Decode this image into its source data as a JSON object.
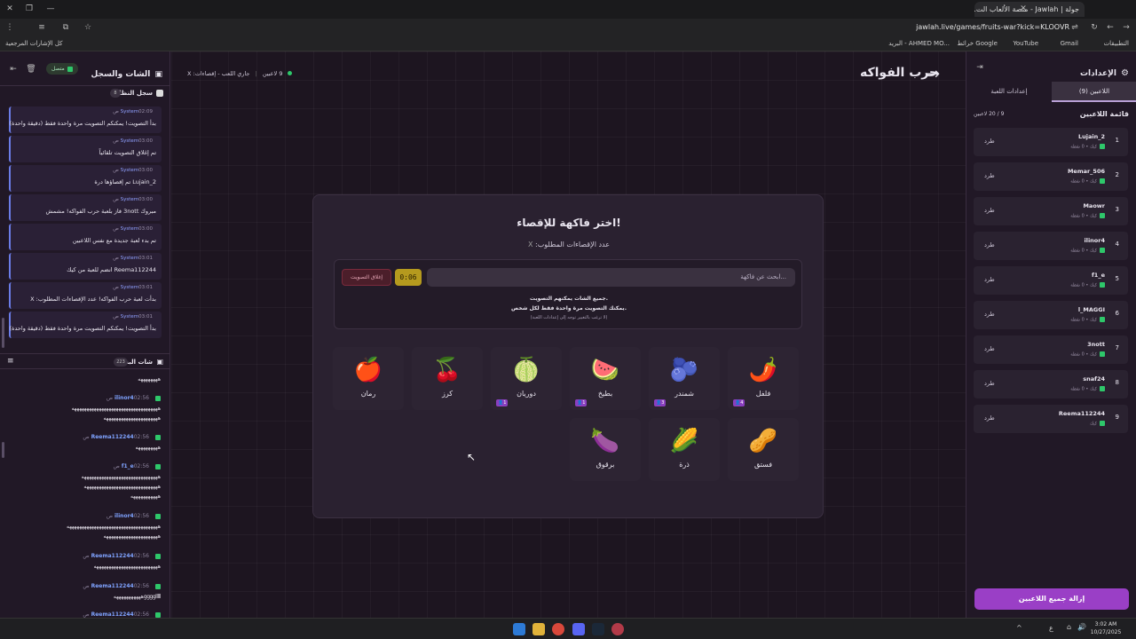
{
  "browser": {
    "tab_title": "جولة | Jawlah - منصة الألعاب الت...",
    "url": "jawlah.live/games/fruits-war?kick=KLOOVR",
    "bookmarks": [
      "التطبيقات",
      "Gmail",
      "YouTube",
      "خرائط Google",
      "البريد - AHMED MO..."
    ],
    "bookmarks_all": "كل الإشارات المرجعية"
  },
  "left": {
    "chat_title": "الشات والسجل",
    "status": "متصل",
    "system_log_title": "سجل النظام",
    "system_log_count": "8",
    "logs": [
      {
        "user": "System",
        "time": "02:09 ص",
        "text": "بدأ التصويت! يمكنكم التصويت مرة واحدة فقط (دقيقة واحدة)"
      },
      {
        "user": "System",
        "time": "03:00 ص",
        "text": "تم إغلاق التصويت تلقائياً"
      },
      {
        "user": "System",
        "time": "03:00 ص",
        "text": "Lujain_2 تم إقصاؤها درة"
      },
      {
        "user": "System",
        "time": "03:00 ص",
        "text": "مبروك 3nott فاز بلعبة حرب الفواكه! مشمش"
      },
      {
        "user": "System",
        "time": "03:00 ص",
        "text": "تم بدء لعبة جديدة مع نفس اللاعبين"
      },
      {
        "user": "System",
        "time": "03:01 ص",
        "text": "Reema112244 انضم للعبة من كيك"
      },
      {
        "user": "System",
        "time": "03:01 ص",
        "text": "بدأت لعبة حرب الفواكه! عدد الإقصاءات المطلوب: X"
      },
      {
        "user": "System",
        "time": "03:01 ص",
        "text": "بدأ التصويت! يمكنكم التصويت مرة واحدة فقط (دقيقة واحدة)"
      }
    ],
    "live_chat_title": "شات البث",
    "live_chat_count": "223",
    "chats": [
      {
        "user": "",
        "time": "",
        "lines": [
          "ههههههههه"
        ]
      },
      {
        "user": "ilinor4",
        "time": "02:56 ص",
        "lines": [
          "هههههههههههههههههههههههههههههههههههه",
          "ههههههههههههههههههههههه"
        ]
      },
      {
        "user": "Reema112244",
        "time": "02:56 ص",
        "lines": [
          "هههههههههه"
        ]
      },
      {
        "user": "f1_e",
        "time": "02:56 ص",
        "lines": [
          "هههههههههههههههههههههههههههههههه",
          "ههههههههههههههههههههههههههههههه",
          "هههههههههههه"
        ]
      },
      {
        "user": "ilinor4",
        "time": "02:56 ص",
        "lines": [
          "هههههههههههههههههههههههههههههههههههههه",
          "ههههههههههههههههههههههه"
        ]
      },
      {
        "user": "Reema112244",
        "time": "02:56 ص",
        "lines": [
          "ههههههههههههههههههههههههههه"
        ]
      },
      {
        "user": "Reema112244",
        "time": "02:56 ص",
        "lines": [
          "gggglllllهههههههههههه"
        ]
      },
      {
        "user": "Reema112244",
        "time": "02:56 ص",
        "lines": []
      }
    ]
  },
  "center": {
    "title": "حرب الفواكه",
    "players_online": "9 لاعبين",
    "game_status": "جاري اللعب - إقصاءات: X",
    "modal_title": "اختر فاكهة للإقصاء!",
    "required_label": "عدد الإقصاءات المطلوب:",
    "required_value": "X",
    "search_placeholder": "ابحث عن فاكهة...",
    "timer": "0:06",
    "close_vote": "إغلاق التصويت",
    "info1": "جميع الشات يمكنهم التصويت.",
    "info2": "يمكنك التصويت مرة واحدة فقط لكل شخص.",
    "info3": "(لا ترغب بالتغيير توجه إلى إعدادات اللعبة)",
    "fruits": [
      {
        "name": "فلفل",
        "emoji": "🌶️",
        "votes": "4"
      },
      {
        "name": "شمندر",
        "emoji": "🫐",
        "votes": "3"
      },
      {
        "name": "بطيخ",
        "emoji": "🍉",
        "votes": "1"
      },
      {
        "name": "دوريان",
        "emoji": "🍈",
        "votes": "1"
      },
      {
        "name": "كرز",
        "emoji": "🍒",
        "votes": ""
      },
      {
        "name": "رمان",
        "emoji": "🍎",
        "votes": ""
      },
      {
        "name": "فستق",
        "emoji": "🥜",
        "votes": ""
      },
      {
        "name": "ذرة",
        "emoji": "🌽",
        "votes": ""
      },
      {
        "name": "برقوق",
        "emoji": "🍆",
        "votes": ""
      }
    ]
  },
  "right": {
    "settings_title": "الإعدادات",
    "tab_players": "اللاعبين (9)",
    "tab_settings": "إعدادات اللعبة",
    "list_title": "قائمة اللاعبين",
    "list_count": "9 / 20 لاعبين",
    "kick_label": "طرد",
    "players": [
      {
        "num": "1",
        "name": "Lujain_2",
        "score": "كيك • 0 نقطة"
      },
      {
        "num": "2",
        "name": "Memar_506",
        "score": "كيك • 0 نقطة"
      },
      {
        "num": "3",
        "name": "Maowr",
        "score": "كيك • 0 نقطة"
      },
      {
        "num": "4",
        "name": "ilinor4",
        "score": "كيك • 0 نقطة"
      },
      {
        "num": "5",
        "name": "f1_e",
        "score": "كيك • 0 نقطة"
      },
      {
        "num": "6",
        "name": "l_MAGGI",
        "score": "كيك • 0 نقطة"
      },
      {
        "num": "7",
        "name": "3nott",
        "score": "كيك • 0 نقطة"
      },
      {
        "num": "8",
        "name": "snaf24",
        "score": "كيك • 0 نقطة"
      },
      {
        "num": "9",
        "name": "Reema112244",
        "score": "كيك"
      }
    ],
    "remove_all": "إزالة جميع اللاعبين"
  },
  "taskbar": {
    "time": "3:02 AM",
    "date": "10/27/2025",
    "lang": "ع"
  }
}
